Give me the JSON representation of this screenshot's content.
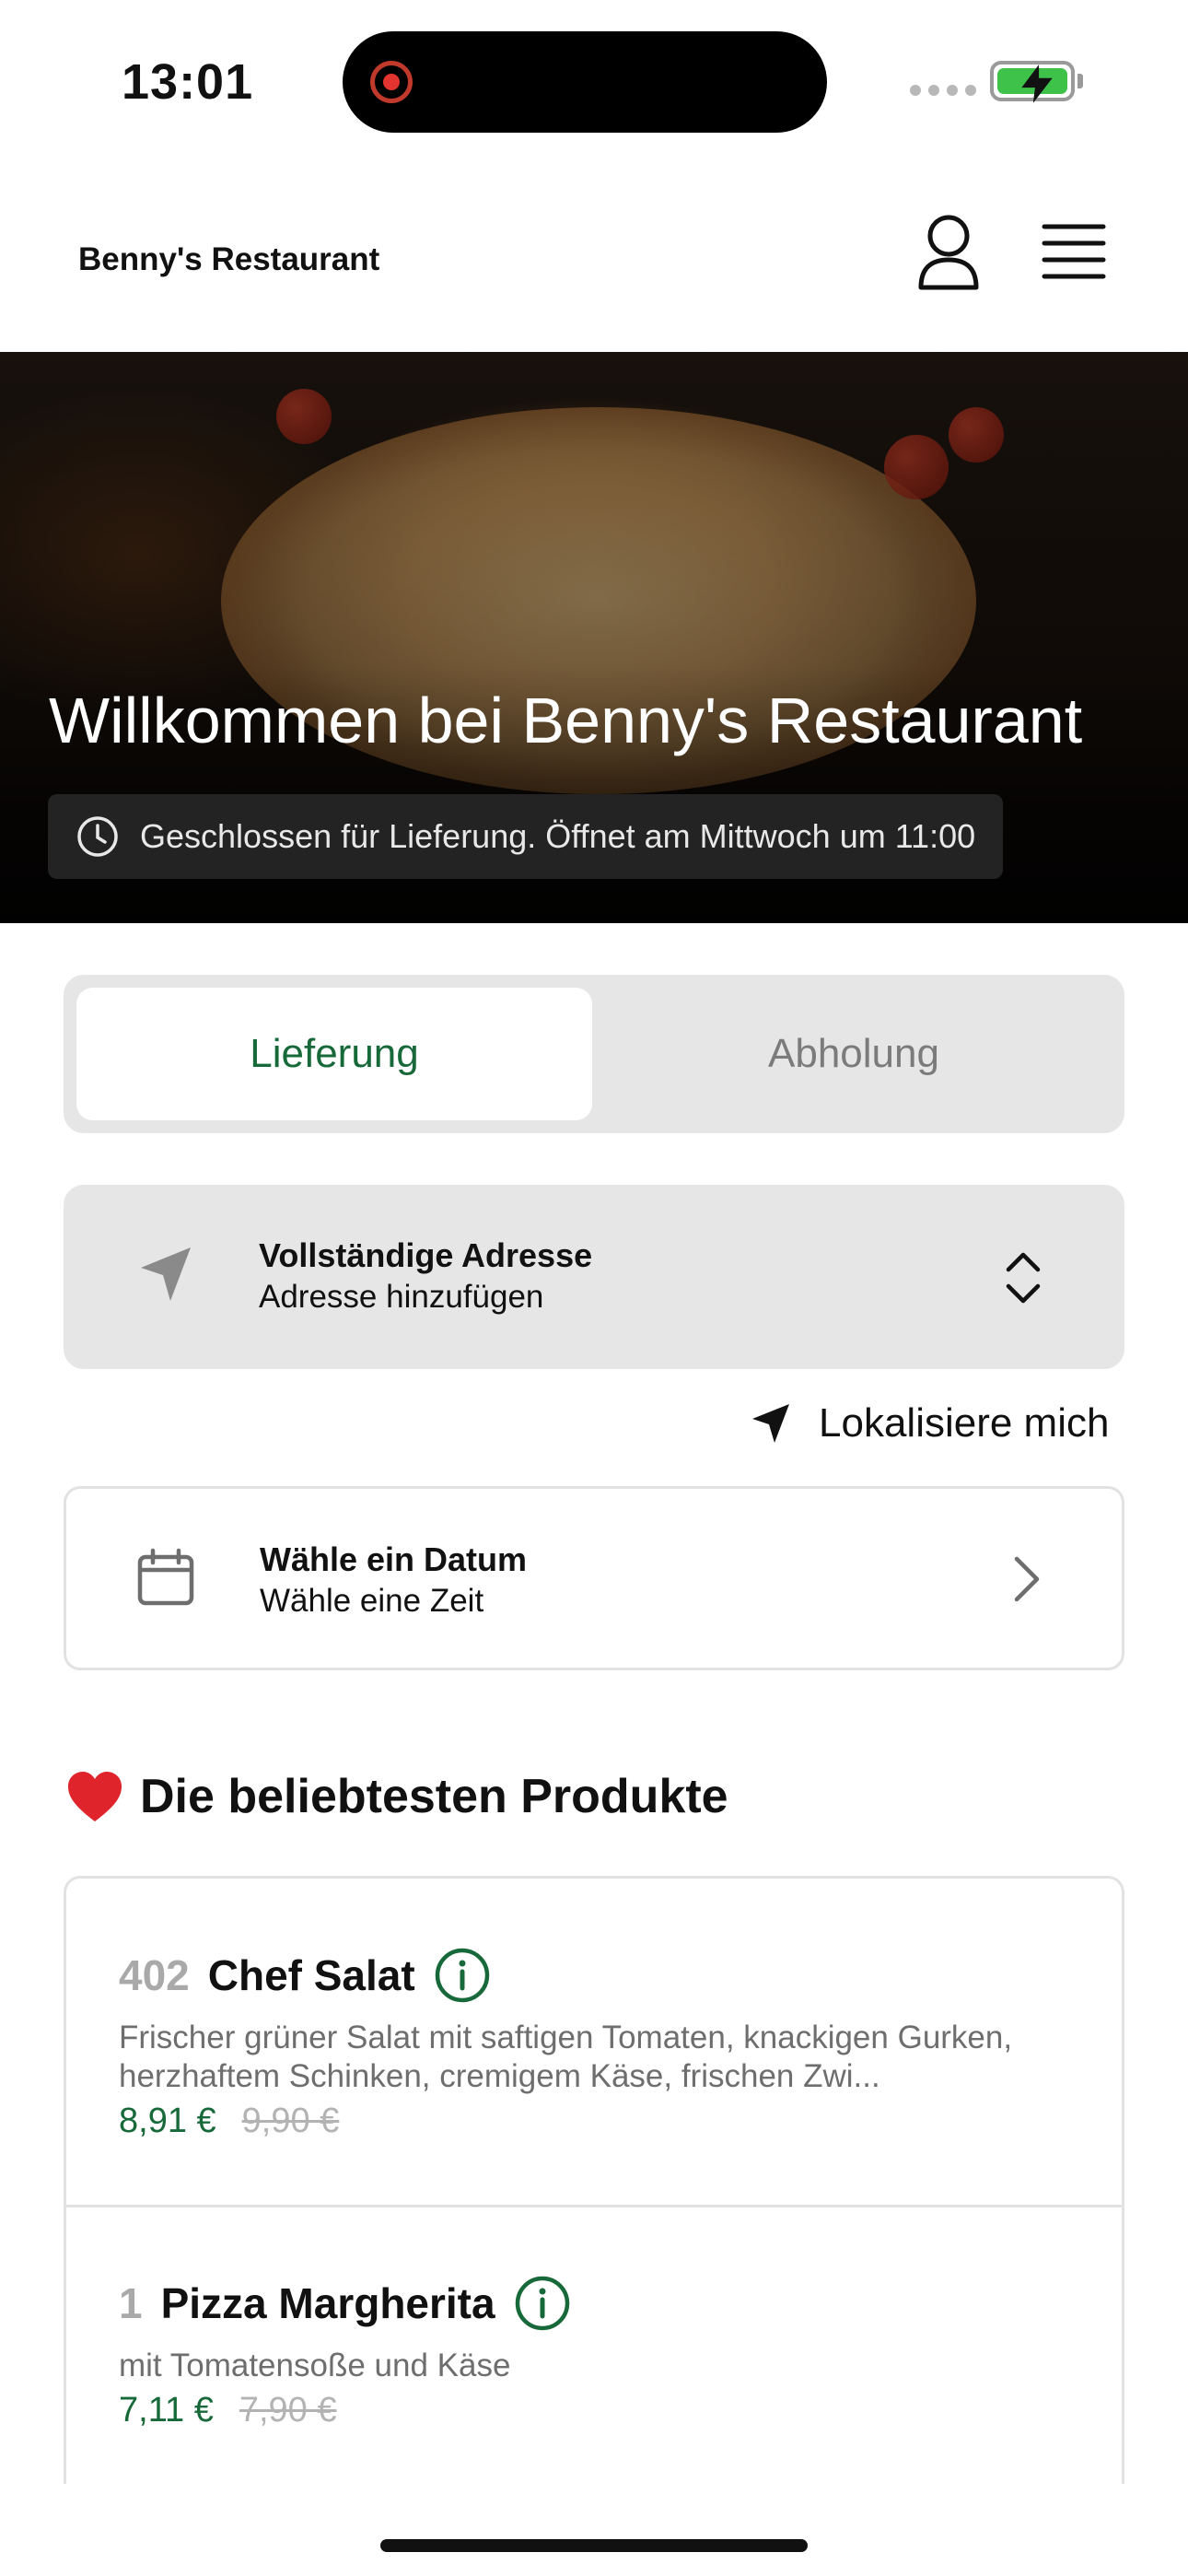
{
  "status_bar": {
    "time": "13:01"
  },
  "header": {
    "brand": "Benny's Restaurant"
  },
  "hero": {
    "title": "Willkommen bei Benny's Restaurant",
    "status": "Geschlossen für Lieferung. Öffnet am Mittwoch um 11:00"
  },
  "order_mode": {
    "tabs": [
      {
        "label": "Lieferung",
        "active": true
      },
      {
        "label": "Abholung",
        "active": false
      }
    ]
  },
  "address": {
    "title": "Vollständige Adresse",
    "subtitle": "Adresse hinzufügen"
  },
  "locate_label": "Lokalisiere mich",
  "schedule": {
    "title": "Wähle ein Datum",
    "subtitle": "Wähle eine Zeit"
  },
  "popular": {
    "emoji": "❤️",
    "title": "Die beliebtesten Produkte",
    "products": [
      {
        "number": "402",
        "name": "Chef Salat",
        "description": "Frischer grüner Salat mit saftigen Tomaten, knackigen Gurken, herzhaftem Schinken, cremigem Käse,  frischen Zwi...",
        "price": "8,91 €",
        "old_price": "9,90 €"
      },
      {
        "number": "1",
        "name": "Pizza Margherita",
        "description": "mit Tomatensoße und Käse",
        "price": "7,11 €",
        "old_price": "7,90 €"
      }
    ]
  },
  "colors": {
    "accent_green": "#17693a",
    "battery_green": "#3fc24a",
    "segment_bg": "#e6e6e6"
  },
  "icons": [
    "record-icon",
    "battery-icon",
    "user-icon",
    "menu-icon",
    "clock-icon",
    "location-arrow-icon",
    "chevron-up-down-icon",
    "calendar-icon",
    "chevron-right-icon",
    "heart-icon",
    "info-icon"
  ]
}
